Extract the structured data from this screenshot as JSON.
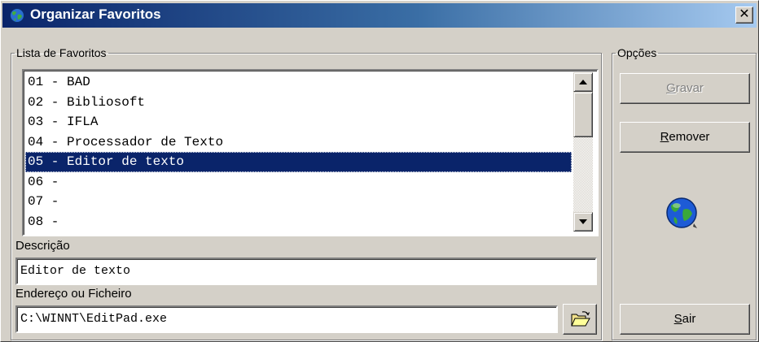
{
  "window": {
    "title": "Organizar Favoritos",
    "close_label": "✕",
    "title_icon": "globe-app-icon"
  },
  "list_group": {
    "legend": "Lista de Favoritos",
    "items": [
      "01 - BAD",
      "02 - Bibliosoft",
      "03 - IFLA",
      "04 - Processador de Texto",
      "05 - Editor de texto",
      "06 -",
      "07 -",
      "08 -"
    ],
    "selected_index": 4
  },
  "description": {
    "label": "Descrição",
    "value": "Editor de texto"
  },
  "address": {
    "label": "Endereço ou Ficheiro",
    "value": "C:\\WINNT\\EditPad.exe",
    "browse_icon": "open-folder-icon"
  },
  "options_group": {
    "legend": "Opções",
    "save": {
      "accel": "G",
      "rest": "ravar",
      "enabled": false
    },
    "remove": {
      "accel": "R",
      "rest": "emover",
      "enabled": true
    },
    "exit": {
      "accel": "S",
      "rest": "air",
      "enabled": true
    },
    "decoration_icon": "globe-icon"
  },
  "colors": {
    "title_gradient_start": "#0a246a",
    "title_gradient_end": "#a6caf0",
    "selection": "#0a246a",
    "face": "#d4d0c8"
  }
}
